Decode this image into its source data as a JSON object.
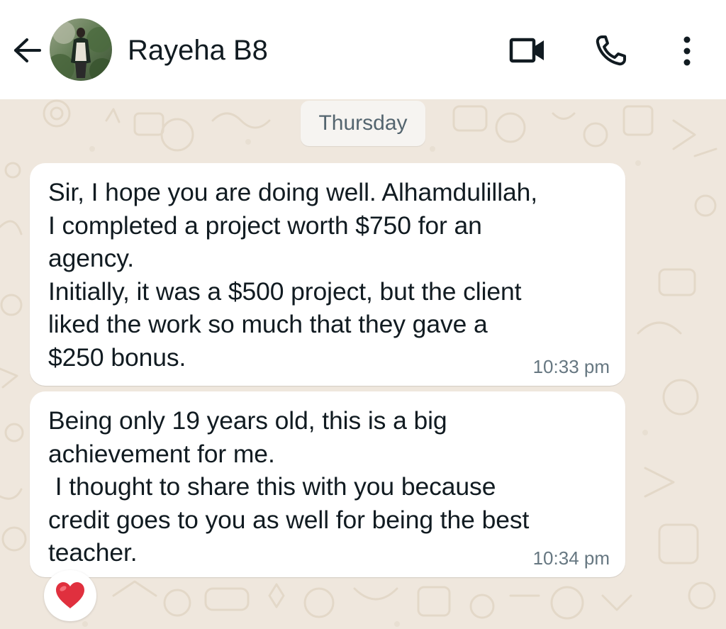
{
  "header": {
    "contact_name": "Rayeha B8",
    "icons": {
      "back": "arrow-left-icon",
      "video": "video-camera-icon",
      "call": "phone-icon",
      "menu": "more-vertical-icon"
    }
  },
  "chat": {
    "date_label": "Thursday",
    "messages": [
      {
        "text": "Sir, I hope you are doing well. Alhamdulillah,\nI completed a project worth $750 for an\nagency.\nInitially, it was a $500 project, but the client\nliked the work so much that they gave a\n$250 bonus.",
        "time": "10:33 pm"
      },
      {
        "text": "Being only 19 years old, this is a big\nachievement for me.\n I thought to share this with you because\ncredit goes to you as well for being the best\nteacher.",
        "time": "10:34 pm"
      }
    ],
    "reaction": "heart-emoji"
  },
  "colors": {
    "chat_background": "#efe7dd",
    "bubble": "#ffffff",
    "text": "#111b21",
    "timestamp": "#667781",
    "heart": "#e0303e"
  }
}
